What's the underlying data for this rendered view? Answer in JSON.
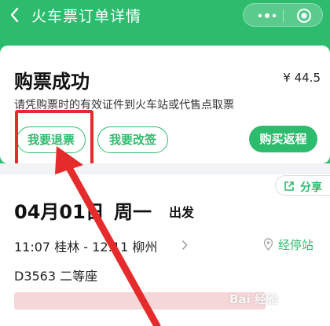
{
  "header": {
    "title": "火车票订单详情",
    "back_icon": "chevron-left-icon",
    "capsule_icons": [
      "more-icon",
      "close-circle-icon"
    ]
  },
  "order": {
    "status_title": "购票成功",
    "price": "¥ 44.5",
    "notice": "请凭购票时的有效证件到火车站或代售点取票",
    "buttons": {
      "refund": "我要退票",
      "change": "我要改签",
      "return": "购买返程"
    }
  },
  "trip": {
    "share_label": "分享",
    "date": "04月01日",
    "weekday": "周一",
    "depart_label": "出发",
    "route": "11:07 桂林 - 12:11 柳州",
    "stops_label": "经停站",
    "train": "D3563 二等座"
  },
  "watermark": "Bai 经验",
  "colors": {
    "brand_green": "#2dbb6e",
    "highlight_red": "#e52b2b"
  }
}
